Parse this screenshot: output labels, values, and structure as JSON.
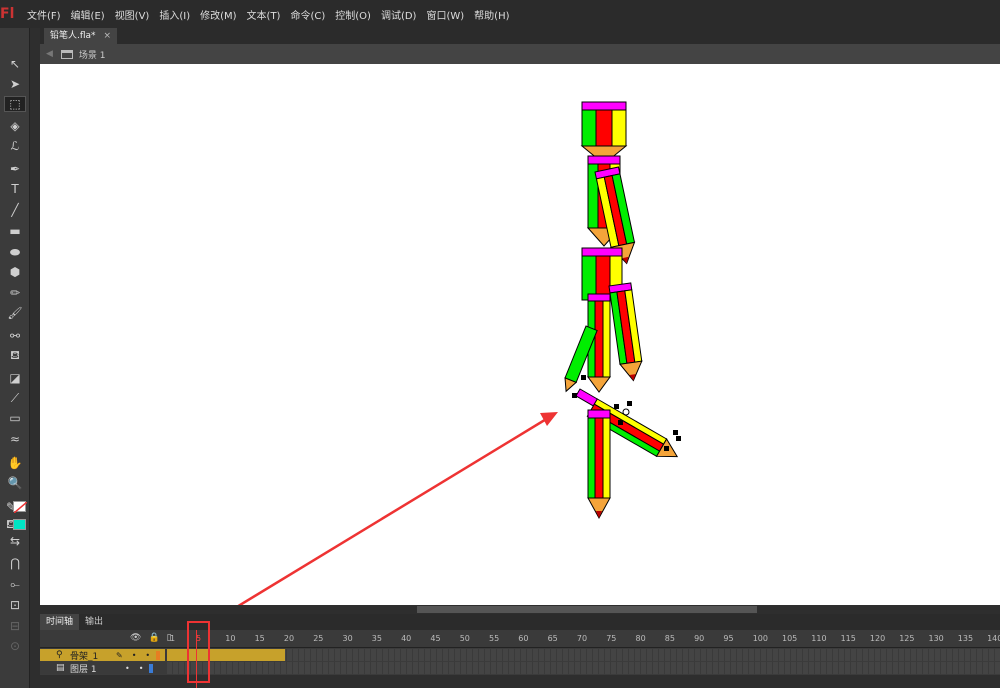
{
  "app": {
    "logo": "Fl"
  },
  "menu": [
    "文件(F)",
    "编辑(E)",
    "视图(V)",
    "插入(I)",
    "修改(M)",
    "文本(T)",
    "命令(C)",
    "控制(O)",
    "调试(D)",
    "窗口(W)",
    "帮助(H)"
  ],
  "document_tab": {
    "title": "铅笔人.fla*",
    "close": "×"
  },
  "editbar": {
    "scene": "场景 1"
  },
  "panel_tabs": [
    "时间轴",
    "输出"
  ],
  "timeline": {
    "ruler_ticks": [
      "1",
      "5",
      "10",
      "15",
      "20",
      "25",
      "30",
      "35",
      "40",
      "45",
      "50",
      "55",
      "60",
      "65",
      "70",
      "75",
      "80",
      "85",
      "90",
      "95",
      "100",
      "105",
      "110",
      "115",
      "120",
      "125",
      "130",
      "135",
      "140"
    ],
    "current_frame": "5",
    "layers": [
      {
        "name": "骨架_1",
        "icon": "armature-icon",
        "color": "#e67e22"
      },
      {
        "name": "图层 1",
        "icon": "layer-icon",
        "color": "#3a7bd5"
      }
    ]
  },
  "colors": {
    "layer_highlight": "#c7a12b",
    "annotation": "#e33333",
    "fill_swatch": "#00e5c4"
  },
  "tools": [
    "selection-tool",
    "subselection-tool",
    "free-transform-tool",
    "3d-rotation-tool",
    "lasso-tool",
    "pen-tool",
    "text-tool",
    "line-tool",
    "rectangle-tool",
    "oval-tool",
    "polystar-tool",
    "pencil-tool",
    "brush-tool",
    "bone-tool",
    "paint-bucket-tool",
    "ink-bottle-tool",
    "eyedropper-tool",
    "eraser-tool",
    "width-tool",
    "hand-tool",
    "zoom-tool",
    "stroke-color",
    "fill-color",
    "swap-colors",
    "snap-magnet",
    "smooth",
    "straighten"
  ]
}
